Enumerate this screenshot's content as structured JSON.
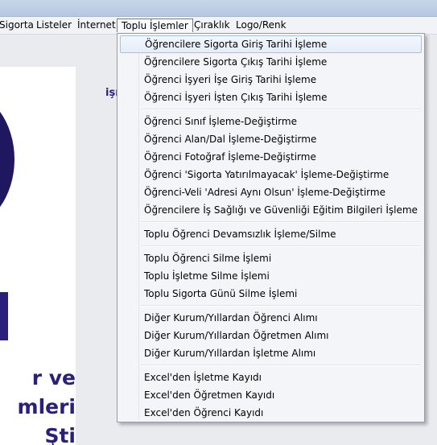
{
  "menubar": {
    "items": [
      "Sigorta",
      "Listeler",
      "İnternet",
      "Toplu İşlemler",
      "Çıraklık",
      "Logo/Renk"
    ]
  },
  "background": {
    "side_label": "işı",
    "logo_lines": [
      "r  ve",
      "mleri",
      "Şti"
    ]
  },
  "dropdown": {
    "groups": [
      [
        "Öğrencilere Sigorta Giriş Tarihi İşleme",
        "Öğrencilere Sigorta Çıkış Tarihi İşleme",
        "Öğrenci İşyeri İşe Giriş Tarihi İşleme",
        "Öğrenci İşyeri İşten Çıkış Tarihi İşleme"
      ],
      [
        "Öğrenci Sınıf İşleme-Değiştirme",
        "Öğrenci Alan/Dal İşleme-Değiştirme",
        "Öğrenci Fotoğraf İşleme-Değiştirme",
        "Öğrenci 'Sigorta Yatırılmayacak' İşleme-Değiştirme",
        "Öğrenci-Veli 'Adresi Aynı Olsun' İşleme-Değiştirme",
        "Öğrencilere İş Sağlığı ve Güvenliği Eğitim Bilgileri İşleme"
      ],
      [
        "Toplu Öğrenci Devamsızlık İşleme/Silme"
      ],
      [
        "Toplu Öğrenci Silme İşlemi",
        "Toplu İşletme Silme İşlemi",
        "Toplu Sigorta Günü Silme İşlemi"
      ],
      [
        "Diğer Kurum/Yıllardan Öğrenci Alımı",
        "Diğer Kurum/Yıllardan Öğretmen Alımı",
        "Diğer Kurum/Yıllardan İşletme Alımı"
      ],
      [
        "Excel'den İşletme Kayıdı",
        "Excel'den Öğretmen Kayıdı",
        "Excel'den Öğrenci Kayıdı"
      ]
    ]
  },
  "colors": {
    "brand": "#2a1f7a",
    "menu_highlight": "#e4edf9",
    "menu_highlight_border": "#a8c2e3"
  }
}
